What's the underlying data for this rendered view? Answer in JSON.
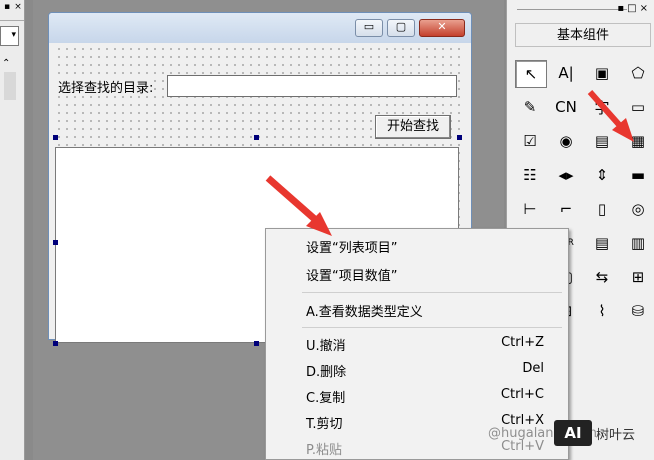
{
  "left_panel": {
    "pin_button": "▪",
    "close_button": "×",
    "combo_arrow": "▾",
    "scroll_up": "⌃"
  },
  "form": {
    "directory_label": "选择查找的目录:",
    "directory_value": "",
    "search_button": "开始查找",
    "window_buttons": {
      "minimize": "▭",
      "maximize": "▢",
      "close": "✕"
    }
  },
  "palette": {
    "top_controls": "▪□×",
    "header": "基本组件",
    "tools": [
      {
        "name": "pointer-icon",
        "glyph": "↖"
      },
      {
        "name": "label-icon",
        "glyph": "A|"
      },
      {
        "name": "picture-icon",
        "glyph": "▣"
      },
      {
        "name": "shape-icon",
        "glyph": "⬠"
      },
      {
        "name": "edit-icon",
        "glyph": "✎"
      },
      {
        "name": "cn-edit-icon",
        "glyph": "CN"
      },
      {
        "name": "font-icon",
        "glyph": "字"
      },
      {
        "name": "button-icon",
        "glyph": "▭"
      },
      {
        "name": "checkbox-icon",
        "glyph": "☑"
      },
      {
        "name": "radio-icon",
        "glyph": "◉"
      },
      {
        "name": "listbox-icon",
        "glyph": "▤"
      },
      {
        "name": "list-view-icon",
        "glyph": "▦"
      },
      {
        "name": "combo-list-icon",
        "glyph": "☷"
      },
      {
        "name": "scrollbar-h-icon",
        "glyph": "◂▸"
      },
      {
        "name": "spin-icon",
        "glyph": "⇕"
      },
      {
        "name": "progress-icon",
        "glyph": "▬"
      },
      {
        "name": "slider-icon",
        "glyph": "⊢"
      },
      {
        "name": "frame-icon",
        "glyph": "⌐"
      },
      {
        "name": "tab-icon",
        "glyph": "▯"
      },
      {
        "name": "camera-icon",
        "glyph": "◎"
      },
      {
        "name": "folder-icon",
        "glyph": "▰"
      },
      {
        "name": "dir-icon",
        "glyph": "DIR"
      },
      {
        "name": "document-icon",
        "glyph": "▤"
      },
      {
        "name": "tool-icon-24",
        "glyph": "▥"
      },
      {
        "name": "tool-icon-25",
        "glyph": "⇅"
      },
      {
        "name": "window-icon",
        "glyph": "▢"
      },
      {
        "name": "transfer-icon",
        "glyph": "⇆"
      },
      {
        "name": "network-icon",
        "glyph": "⊞"
      },
      {
        "name": "grid-icon",
        "glyph": "▦"
      },
      {
        "name": "tree-icon",
        "glyph": "⊟"
      },
      {
        "name": "chart-icon",
        "glyph": "⌇"
      },
      {
        "name": "odbc-icon",
        "glyph": "⛁"
      }
    ]
  },
  "context_menu": {
    "items": [
      {
        "label": "设置“列表项目”",
        "shortcut": "",
        "disabled": false
      },
      {
        "label": "设置“项目数值”",
        "shortcut": "",
        "disabled": false
      },
      {
        "label": "A.查看数据类型定义",
        "shortcut": "",
        "disabled": false
      },
      {
        "label": "U.撤消",
        "shortcut": "Ctrl+Z",
        "disabled": false
      },
      {
        "label": "D.删除",
        "shortcut": "Del",
        "disabled": false
      },
      {
        "label": "C.复制",
        "shortcut": "Ctrl+C",
        "disabled": false
      },
      {
        "label": "T.剪切",
        "shortcut": "Ctrl+X",
        "disabled": false
      },
      {
        "label": "P.粘贴",
        "shortcut": "Ctrl+V",
        "disabled": true
      }
    ]
  },
  "watermark": {
    "handle": "@hugalanglanjin",
    "logo": "AI",
    "text": "树叶云"
  },
  "colors": {
    "arrow": "#e8372f",
    "workspace": "#8f8f8f",
    "selection_handle": "#00007a"
  }
}
